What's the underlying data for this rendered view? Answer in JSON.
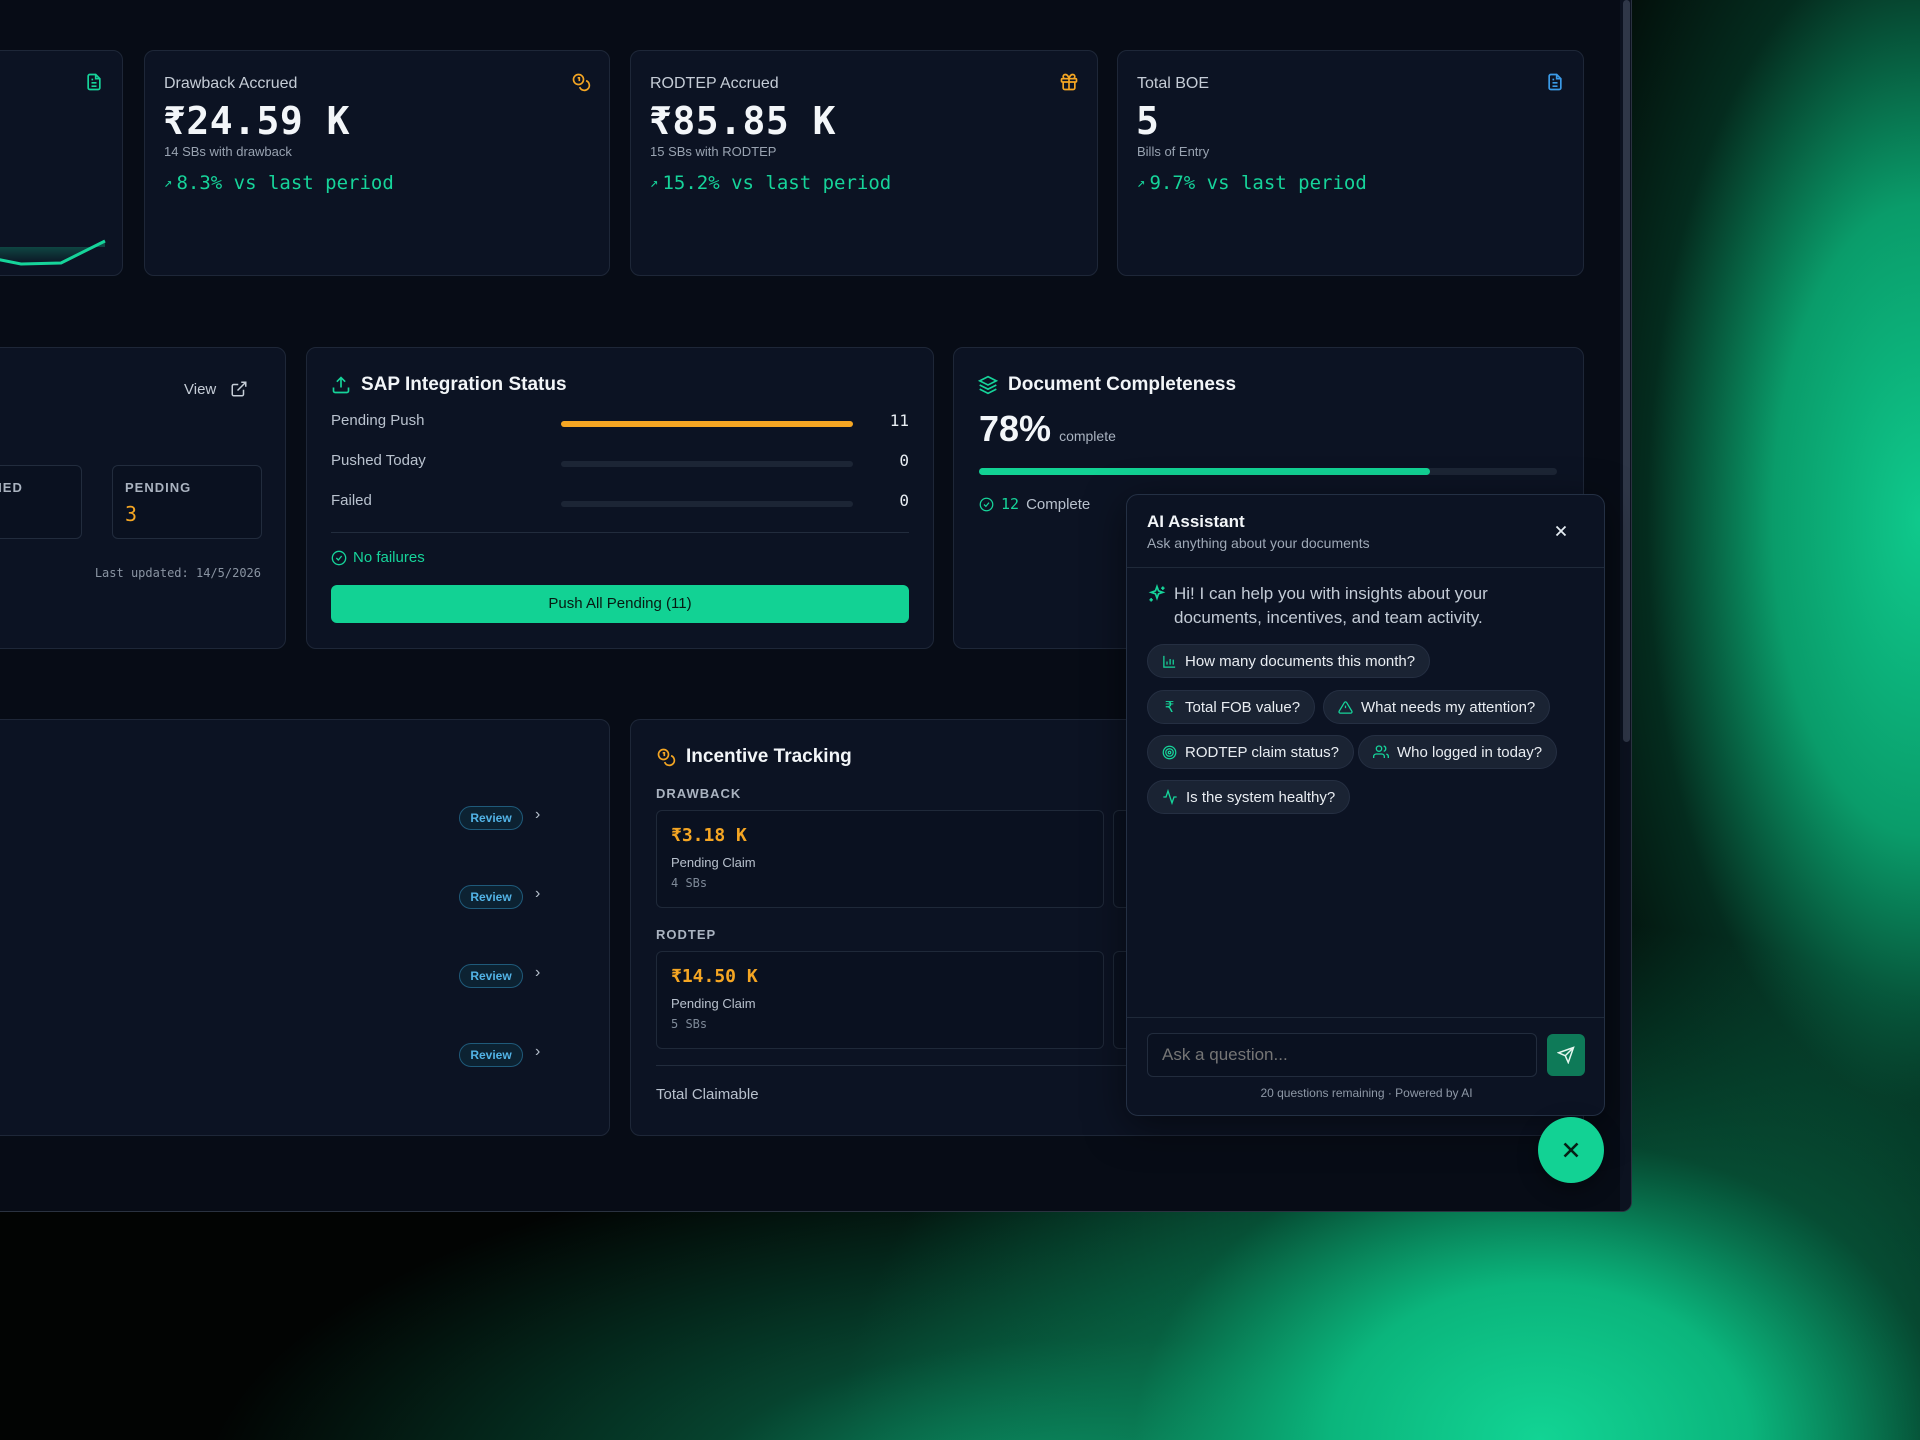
{
  "stats": [
    {
      "label": "Drawback Accrued",
      "value": "₹24.59 K",
      "sub": "14 SBs with drawback",
      "trend": "8.3% vs last period",
      "icon": "coins-icon",
      "icon_color": "#f5a623"
    },
    {
      "label": "RODTEP Accrued",
      "value": "₹85.85 K",
      "sub": "15 SBs with RODTEP",
      "trend": "15.2% vs last period",
      "icon": "gift-icon",
      "icon_color": "#f5a623"
    },
    {
      "label": "Total BOE",
      "value": "5",
      "sub": "Bills of Entry",
      "trend": "9.7% vs last period",
      "icon": "file-icon",
      "icon_color": "#3b9be8"
    }
  ],
  "partial_card": {
    "icon": "file-icon",
    "icon_color": "#16d49a"
  },
  "match_panel": {
    "view_label": "View",
    "cells": [
      {
        "label": "CHED",
        "value": ""
      },
      {
        "label": "PENDING",
        "value": "3"
      }
    ],
    "last_updated": "Last updated: 14/5/2026"
  },
  "sap": {
    "title": "SAP Integration Status",
    "rows": [
      {
        "label": "Pending Push",
        "value": "11",
        "fill": 1.0
      },
      {
        "label": "Pushed Today",
        "value": "0",
        "fill": 0
      },
      {
        "label": "Failed",
        "value": "0",
        "fill": 0
      }
    ],
    "status": "No failures",
    "button": "Push All Pending (11)"
  },
  "completeness": {
    "title": "Document Completeness",
    "percent": "78%",
    "percent_label": "complete",
    "progress": 0.78,
    "complete_count": "12",
    "complete_label": "Complete"
  },
  "review_list": {
    "badge": "Review"
  },
  "incentive": {
    "title": "Incentive Tracking",
    "drawback_label": "DRAWBACK",
    "drawback": {
      "amount": "₹3.18 K",
      "label": "Pending Claim",
      "count": "4 SBs"
    },
    "rodtep_label": "RODTEP",
    "rodtep": {
      "amount": "₹14.50 K",
      "label": "Pending Claim",
      "count": "5 SBs"
    },
    "total_label": "Total Claimable"
  },
  "ai": {
    "title": "AI Assistant",
    "subtitle": "Ask anything about your documents",
    "greeting": "Hi! I can help you with insights about your documents, incentives, and team activity.",
    "suggestions": [
      {
        "text": "How many documents this month?",
        "icon": "bar-chart-icon"
      },
      {
        "text": "Total FOB value?",
        "icon": "rupee-icon"
      },
      {
        "text": "What needs my attention?",
        "icon": "alert-triangle-icon"
      },
      {
        "text": "RODTEP claim status?",
        "icon": "target-icon"
      },
      {
        "text": "Who logged in today?",
        "icon": "users-icon"
      },
      {
        "text": "Is the system healthy?",
        "icon": "activity-icon"
      }
    ],
    "input_placeholder": "Ask a question...",
    "footer": "20 questions remaining · Powered by AI"
  },
  "colors": {
    "accent": "#12d294",
    "warning": "#f5a623",
    "info": "#3b9be8"
  }
}
